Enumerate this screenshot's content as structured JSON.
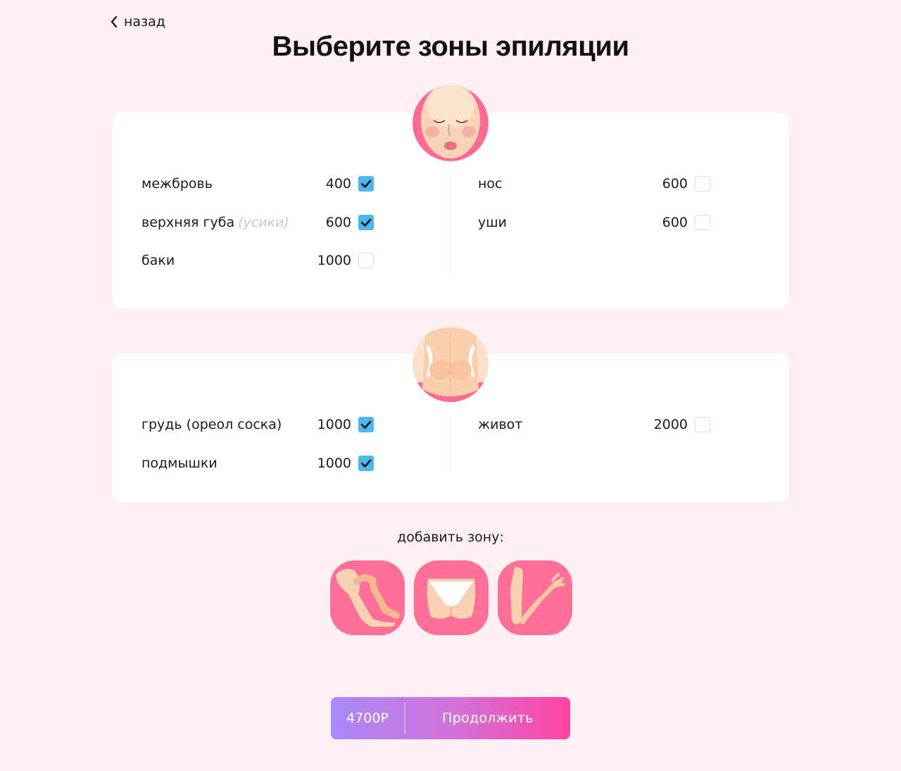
{
  "nav": {
    "back_label": "назад"
  },
  "title": "Выберите зоны эпиляции",
  "face_section": {
    "left": [
      {
        "label": "межбровь",
        "hint": "",
        "price": "400",
        "checked": true
      },
      {
        "label": "верхняя губа",
        "hint": "(усики)",
        "price": "600",
        "checked": true
      },
      {
        "label": "баки",
        "hint": "",
        "price": "1000",
        "checked": false
      }
    ],
    "right": [
      {
        "label": "нос",
        "hint": "",
        "price": "600",
        "checked": false
      },
      {
        "label": "уши",
        "hint": "",
        "price": "600",
        "checked": false
      }
    ]
  },
  "body_section": {
    "left": [
      {
        "label": "грудь (ореол соска)",
        "hint": "",
        "price": "1000",
        "checked": true
      },
      {
        "label": "подмышки",
        "hint": "",
        "price": "1000",
        "checked": true
      }
    ],
    "right": [
      {
        "label": "живот",
        "hint": "",
        "price": "2000",
        "checked": false
      }
    ]
  },
  "add_zone": {
    "label": "добавить зону:",
    "zones": [
      "legs-icon",
      "bikini-icon",
      "arms-icon"
    ]
  },
  "cta": {
    "total": "4700Р",
    "label": "Продолжить"
  },
  "colors": {
    "background": "#fff0f3",
    "checkbox_on": "#4db8f0",
    "zone_button": "#ff6f96",
    "cta_gradient_start": "#a88af8",
    "cta_gradient_end": "#ff43a1"
  }
}
